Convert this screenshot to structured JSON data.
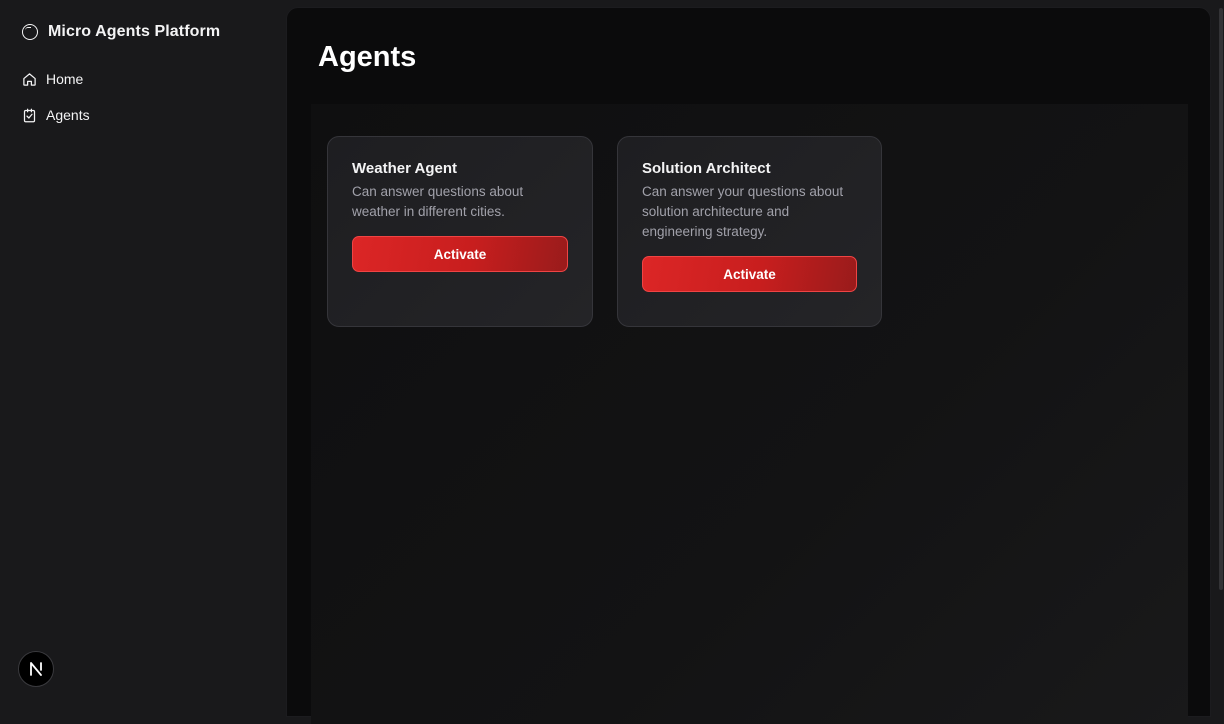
{
  "brand": {
    "name": "Micro Agents Platform",
    "icon": "circle-logo-icon"
  },
  "nav": {
    "items": [
      {
        "label": "Home",
        "icon": "home-icon"
      },
      {
        "label": "Agents",
        "icon": "clipboard-icon"
      }
    ]
  },
  "page": {
    "title": "Agents"
  },
  "agents": [
    {
      "title": "Weather Agent",
      "description": "Can answer questions about weather in different cities.",
      "action_label": "Activate"
    },
    {
      "title": "Solution Architect",
      "description": "Can answer your questions about solution architecture and engineering strategy.",
      "action_label": "Activate"
    }
  ],
  "footer": {
    "badge_icon": "nextjs-logo-icon"
  },
  "colors": {
    "accent": "#dc2626",
    "background": "#19191b",
    "panel": "#0b0b0c"
  }
}
